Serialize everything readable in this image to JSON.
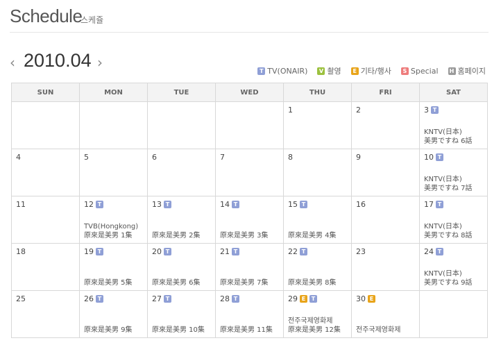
{
  "header": {
    "title": "Schedule",
    "subtitle": "스케쥴"
  },
  "nav": {
    "prev_icon": "‹",
    "next_icon": "›",
    "month": "2010.04"
  },
  "legend": [
    {
      "key": "T",
      "label": "TV(ONAIR)",
      "color": "#8f9fd6"
    },
    {
      "key": "V",
      "label": "촬영",
      "color": "#9cc13f"
    },
    {
      "key": "E",
      "label": "기타/행사",
      "color": "#e8a41a"
    },
    {
      "key": "S",
      "label": "Special",
      "color": "#ee7c7c"
    },
    {
      "key": "H",
      "label": "홈페이지",
      "color": "#9a9a9a"
    }
  ],
  "weekdays": [
    "SUN",
    "MON",
    "TUE",
    "WED",
    "THU",
    "FRI",
    "SAT"
  ],
  "weeks": [
    [
      {
        "day": "",
        "badges": [],
        "events": []
      },
      {
        "day": "",
        "badges": [],
        "events": []
      },
      {
        "day": "",
        "badges": [],
        "events": []
      },
      {
        "day": "",
        "badges": [],
        "events": []
      },
      {
        "day": "1",
        "badges": [],
        "events": []
      },
      {
        "day": "2",
        "badges": [],
        "events": []
      },
      {
        "day": "3",
        "badges": [
          "T"
        ],
        "events": [
          "KNTV(日本)",
          "美男ですね 6話"
        ]
      }
    ],
    [
      {
        "day": "4",
        "badges": [],
        "events": []
      },
      {
        "day": "5",
        "badges": [],
        "events": []
      },
      {
        "day": "6",
        "badges": [],
        "events": []
      },
      {
        "day": "7",
        "badges": [],
        "events": []
      },
      {
        "day": "8",
        "badges": [],
        "events": []
      },
      {
        "day": "9",
        "badges": [],
        "events": []
      },
      {
        "day": "10",
        "badges": [
          "T"
        ],
        "events": [
          "KNTV(日本)",
          "美男ですね 7話"
        ]
      }
    ],
    [
      {
        "day": "11",
        "badges": [],
        "events": []
      },
      {
        "day": "12",
        "badges": [
          "T"
        ],
        "events": [
          "TVB(Hongkong)",
          "原來是美男 1集"
        ]
      },
      {
        "day": "13",
        "badges": [
          "T"
        ],
        "events": [
          "原來是美男 2集"
        ]
      },
      {
        "day": "14",
        "badges": [
          "T"
        ],
        "events": [
          "原來是美男 3集"
        ]
      },
      {
        "day": "15",
        "badges": [
          "T"
        ],
        "events": [
          "原來是美男 4集"
        ]
      },
      {
        "day": "16",
        "badges": [],
        "events": []
      },
      {
        "day": "17",
        "badges": [
          "T"
        ],
        "events": [
          "KNTV(日本)",
          "美男ですね 8話"
        ]
      }
    ],
    [
      {
        "day": "18",
        "badges": [],
        "events": []
      },
      {
        "day": "19",
        "badges": [
          "T"
        ],
        "events": [
          "原來是美男 5集"
        ]
      },
      {
        "day": "20",
        "badges": [
          "T"
        ],
        "events": [
          "原來是美男 6集"
        ]
      },
      {
        "day": "21",
        "badges": [
          "T"
        ],
        "events": [
          "原來是美男 7集"
        ]
      },
      {
        "day": "22",
        "badges": [
          "T"
        ],
        "events": [
          "原來是美男 8集"
        ]
      },
      {
        "day": "23",
        "badges": [],
        "events": []
      },
      {
        "day": "24",
        "badges": [
          "T"
        ],
        "events": [
          "KNTV(日本)",
          "美男ですね 9話"
        ]
      }
    ],
    [
      {
        "day": "25",
        "badges": [],
        "events": []
      },
      {
        "day": "26",
        "badges": [
          "T"
        ],
        "events": [
          "原來是美男 9集"
        ]
      },
      {
        "day": "27",
        "badges": [
          "T"
        ],
        "events": [
          "原來是美男 10集"
        ]
      },
      {
        "day": "28",
        "badges": [
          "T"
        ],
        "events": [
          "原來是美男 11集"
        ]
      },
      {
        "day": "29",
        "badges": [
          "E",
          "T"
        ],
        "events": [
          "전주국제영화제",
          "原來是美男 12集"
        ]
      },
      {
        "day": "30",
        "badges": [
          "E"
        ],
        "events": [
          "전주국제영화제"
        ]
      },
      {
        "day": "",
        "badges": [],
        "events": []
      }
    ]
  ]
}
